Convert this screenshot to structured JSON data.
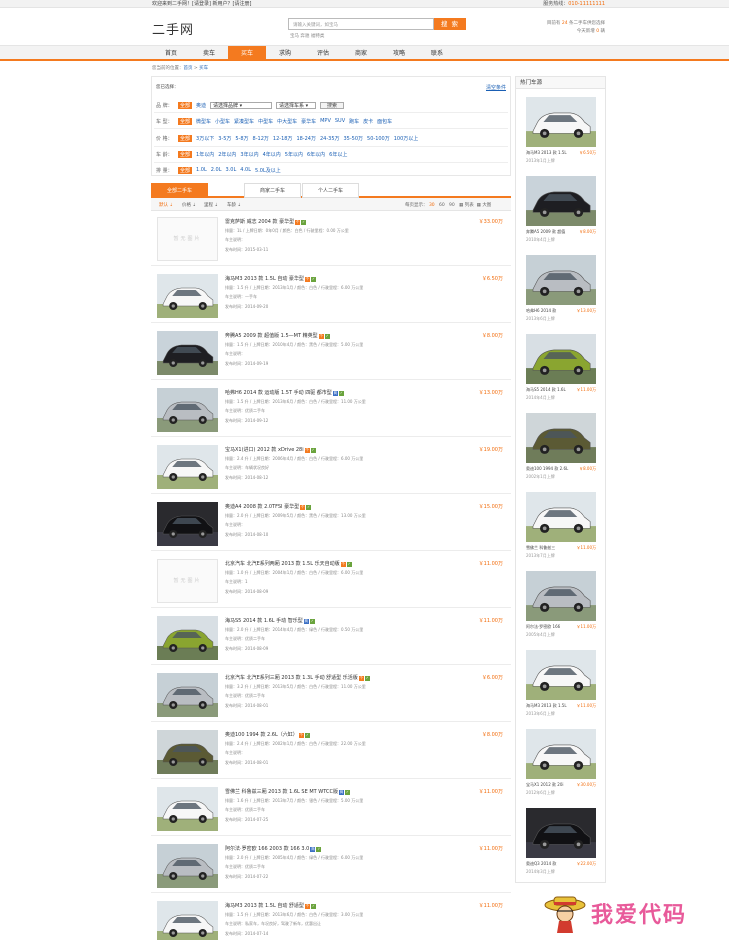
{
  "topbar": {
    "welcome": "欢迎来到二手网！[请登录]  新用户？[请注册]",
    "hotline_label": "服务热线：",
    "hotline": "010-11111111"
  },
  "header": {
    "logo": "二手网",
    "search_placeholder": "请输入关键词，如宝马",
    "search_button": "搜 索",
    "hot_words": "宝马  奔驰  福特类",
    "right_line1_a": "目前有",
    "right_line1_b": "24",
    "right_line1_c": "条二手车供您选择",
    "right_line2_a": "今天新增",
    "right_line2_b": "0",
    "right_line2_c": "辆"
  },
  "nav": {
    "items": [
      {
        "label": "首页",
        "active": false
      },
      {
        "label": "卖车",
        "active": false
      },
      {
        "label": "买车",
        "active": true
      },
      {
        "label": "求购",
        "active": false
      },
      {
        "label": "评估",
        "active": false
      },
      {
        "label": "商家",
        "active": false
      },
      {
        "label": "攻略",
        "active": false
      },
      {
        "label": "联系",
        "active": false
      }
    ]
  },
  "breadcrumb": {
    "prefix": "您当前的位置：",
    "home": "首页",
    "sep": " > ",
    "current": "买车"
  },
  "filters": {
    "selected_label": "您已选择：",
    "clear": "清空条件",
    "brand": {
      "label": "品 牌：",
      "all": "全部",
      "opts": [
        "奥迪"
      ],
      "select1": "请选择品牌",
      "select2": "请选择车系",
      "button": "搜索"
    },
    "cartype": {
      "label": "车 型：",
      "all": "全部",
      "opts": [
        "微型车",
        "小型车",
        "紧凑型车",
        "中型车",
        "中大型车",
        "豪华车",
        "MPV",
        "SUV",
        "跑车",
        "皮卡",
        "面包车"
      ]
    },
    "price": {
      "label": "价 格：",
      "all": "全部",
      "opts": [
        "3万以下",
        "3-5万",
        "5-8万",
        "8-12万",
        "12-18万",
        "18-24万",
        "24-35万",
        "35-50万",
        "50-100万",
        "100万以上"
      ]
    },
    "age": {
      "label": "车 龄：",
      "all": "全部",
      "opts": [
        "1年以内",
        "2年以内",
        "3年以内",
        "4年以内",
        "5年以内",
        "6年以内",
        "6年以上"
      ]
    },
    "disp": {
      "label": "排 量：",
      "all": "全部",
      "opts": [
        "1.0L",
        "2.0L",
        "3.0L",
        "4.0L",
        "5.0L及以上"
      ]
    }
  },
  "tabs": [
    "全部二手车",
    "商家二手车",
    "个人二手车"
  ],
  "sortbar": {
    "items": [
      "默认",
      "价格",
      "里程",
      "车龄"
    ],
    "per_label": "每页显示：",
    "per_opts": [
      "30",
      "60",
      "90"
    ],
    "view_list": "列表",
    "view_big": "大图"
  },
  "no_image": "暂无图片",
  "cars": [
    {
      "title": "雷克萨斯 威志 2004 款 豪华型",
      "tags": [
        "o",
        "g"
      ],
      "price": "￥33.00万",
      "line1": "排量：1L / 上牌日期：0年0月 / 颜色：白色 / 行驶里程：0.00 万公里",
      "line2": "车主说明：",
      "date": "发布时间：2015-03-11",
      "photo": "none"
    },
    {
      "title": "海马M3 2013 款 1.5L 自动 豪华型",
      "tags": [
        "o",
        "g"
      ],
      "price": "￥6.50万",
      "line1": "排量：1.5 升 / 上牌日期：2013年1月 / 颜色：白色 / 行驶里程：6.00 万公里",
      "line2": "车主说明：一手车",
      "date": "发布时间：2014-09-20",
      "photo": "white"
    },
    {
      "title": "奔腾A5 2009 款 超值版 1.5—MT 精英型",
      "tags": [
        "o",
        "g"
      ],
      "price": "￥8.00万",
      "line1": "排量：1.5 升 / 上牌日期：2010年4月 / 颜色：黑色 / 行驶里程：5.00 万公里",
      "line2": "车主说明：",
      "date": "发布时间：2014-09-19",
      "photo": "black"
    },
    {
      "title": "哈弗H6 2014 款 运动版 1.5T 手动 四驱 都市型",
      "tags": [
        "b",
        "g"
      ],
      "price": "￥13.00万",
      "line1": "排量：1.5 升 / 上牌日期：2013年6月 / 颜色：白色 / 行驶里程：11.00 万公里",
      "line2": "车主说明：优质二手车",
      "date": "发布时间：2014-09-12",
      "photo": "silver"
    },
    {
      "title": "宝马X1(进口) 2012 款 xDrive 28i",
      "tags": [
        "o",
        "g"
      ],
      "price": "￥19.00万",
      "line1": "排量：2.4 升 / 上牌日期：2006年4月 / 颜色：白色 / 行驶里程：6.00 万公里",
      "line2": "车主说明：车辆状况良好",
      "date": "发布时间：2014-08-12",
      "photo": "white"
    },
    {
      "title": "奥迪A4 2008 款 2.0TFSI 豪华型",
      "tags": [
        "o",
        "g"
      ],
      "price": "￥15.00万",
      "line1": "排量：2.0 升 / 上牌日期：2009年5月 / 颜色：黑色 / 行驶里程：13.00 万公里",
      "line2": "车主说明：",
      "date": "发布时间：2014-08-10",
      "photo": "dark"
    },
    {
      "title": "北京汽车 北汽E系列两厢 2013 款 1.5L 乐天自动版",
      "tags": [
        "o",
        "g"
      ],
      "price": "￥11.00万",
      "line1": "排量：1.0 升 / 上牌日期：2004年1月 / 颜色：白色 / 行驶里程：6.00 万公里",
      "line2": "车主说明：1",
      "date": "发布时间：2014-08-09",
      "photo": "none"
    },
    {
      "title": "海马S5 2014 款 1.6L 手动 智乐型",
      "tags": [
        "b",
        "g"
      ],
      "price": "￥11.00万",
      "line1": "排量：2.0 升 / 上牌日期：2014年4月 / 颜色：绿色 / 行驶里程：0.50 万公里",
      "line2": "车主说明：优质二手车",
      "date": "发布时间：2014-08-09",
      "photo": "green"
    },
    {
      "title": "北京汽车 北汽E系列三厢 2013 款 1.3L 手动 舒适型 乐活版",
      "tags": [
        "o",
        "g"
      ],
      "price": "￥6.00万",
      "line1": "排量：3.2 升 / 上牌日期：2013年5月 / 颜色：白色 / 行驶里程：11.00 万公里",
      "line2": "车主说明：优质二手车",
      "date": "发布时间：2014-08-01",
      "photo": "silver"
    },
    {
      "title": "奥迪100 1994 款 2.6L（六缸）",
      "tags": [
        "o",
        "g"
      ],
      "price": "￥8.00万",
      "line1": "排量：2.4 升 / 上牌日期：2002年1月 / 颜色：白色 / 行驶里程：22.00 万公里",
      "line2": "车主说明：",
      "date": "发布时间：2014-08-01",
      "photo": "olive"
    },
    {
      "title": "雪佛兰 科鲁兹三厢 2013 款 1.6L SE MT WTCC版",
      "tags": [
        "b",
        "g"
      ],
      "price": "￥11.00万",
      "line1": "排量：1.6 升 / 上牌日期：2013年7月 / 颜色：银色 / 行驶里程：5.00 万公里",
      "line2": "车主说明：优质二手车",
      "date": "发布时间：2014-07-25",
      "photo": "white"
    },
    {
      "title": "阿尔法·罗密欧 166 2003 款 166 3.0",
      "tags": [
        "b",
        "g"
      ],
      "price": "￥11.00万",
      "line1": "排量：2.0 升 / 上牌日期：2005年4月 / 颜色：绿色 / 行驶里程：6.00 万公里",
      "line2": "车主说明：优质二手车",
      "date": "发布时间：2014-07-22",
      "photo": "silver"
    },
    {
      "title": "海马M3 2013 款 1.5L 自动 舒适型",
      "tags": [
        "o",
        "g"
      ],
      "price": "￥11.00万",
      "line1": "排量：1.5 升 / 上牌日期：2013年6月 / 颜色：白色 / 行驶里程：3.00 万公里",
      "line2": "车主说明：私家车，车况良好，驾驶了新车，优惠出让",
      "date": "发布时间：2014-07-14",
      "photo": "white"
    }
  ],
  "side": {
    "title": "热门车源",
    "cards": [
      {
        "name": "海马M3 2013 款 1.5L",
        "price": "￥6.50万",
        "date": "2013年1月上牌",
        "photo": "white"
      },
      {
        "name": "奔腾A5 2009 款 超值",
        "price": "￥8.00万",
        "date": "2010年4月上牌",
        "photo": "black"
      },
      {
        "name": "哈弗H6 2014 款",
        "price": "￥13.00万",
        "date": "2013年6月上牌",
        "photo": "silver"
      },
      {
        "name": "海马S5 2014 款 1.6L",
        "price": "￥11.00万",
        "date": "2014年4月上牌",
        "photo": "green"
      },
      {
        "name": "奥迪100 1994 款 2.6L",
        "price": "￥8.00万",
        "date": "2002年1月上牌",
        "photo": "olive"
      },
      {
        "name": "雪佛兰 科鲁兹三",
        "price": "￥11.00万",
        "date": "2013年7月上牌",
        "photo": "white"
      },
      {
        "name": "阿尔法·罗密欧 166",
        "price": "￥11.00万",
        "date": "2005年4月上牌",
        "photo": "silver"
      },
      {
        "name": "海马M3 2013 款 1.5L",
        "price": "￥11.00万",
        "date": "2013年6月上牌",
        "photo": "white"
      },
      {
        "name": "宝马X1 2012 款 20i",
        "price": "￥30.00万",
        "date": "2012年6月上牌",
        "photo": "white"
      },
      {
        "name": "奥迪Q3 2014 款",
        "price": "￥22.00万",
        "date": "2014年3月上牌",
        "photo": "dark"
      }
    ]
  },
  "brand_logo_text": "我爱代码"
}
